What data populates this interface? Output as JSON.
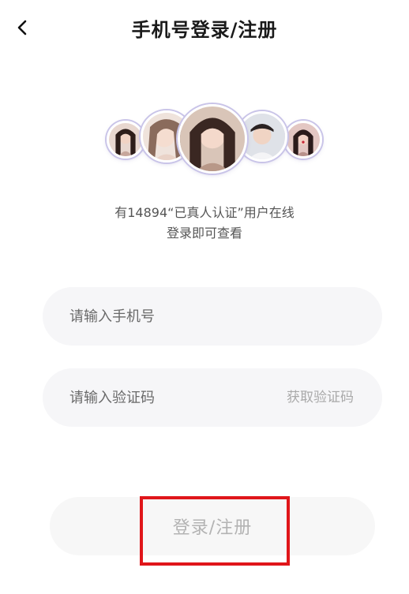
{
  "header": {
    "title": "手机号登录/注册",
    "back_icon": "chevron-left-icon"
  },
  "avatars": [
    {
      "name": "avatar-1",
      "bg": "#d9c3b8"
    },
    {
      "name": "avatar-2",
      "bg": "#e6d7cf"
    },
    {
      "name": "avatar-3",
      "bg": "#d8c6b9"
    },
    {
      "name": "avatar-4",
      "bg": "#d8dbe2"
    },
    {
      "name": "avatar-5",
      "bg": "#d7b8b5"
    }
  ],
  "info": {
    "line1": "有14894“已真人认证”用户在线",
    "line2": "登录即可查看"
  },
  "form": {
    "phone_placeholder": "请输入手机号",
    "code_placeholder": "请输入验证码",
    "get_code_label": "获取验证码",
    "submit_label": "登录/注册"
  },
  "colors": {
    "title": "#1a1a1a",
    "field_bg": "#f6f6f8",
    "button_text_disabled": "#b3b3b3",
    "highlight": "#e0161a",
    "avatar_ring": "#c9c4e8"
  }
}
